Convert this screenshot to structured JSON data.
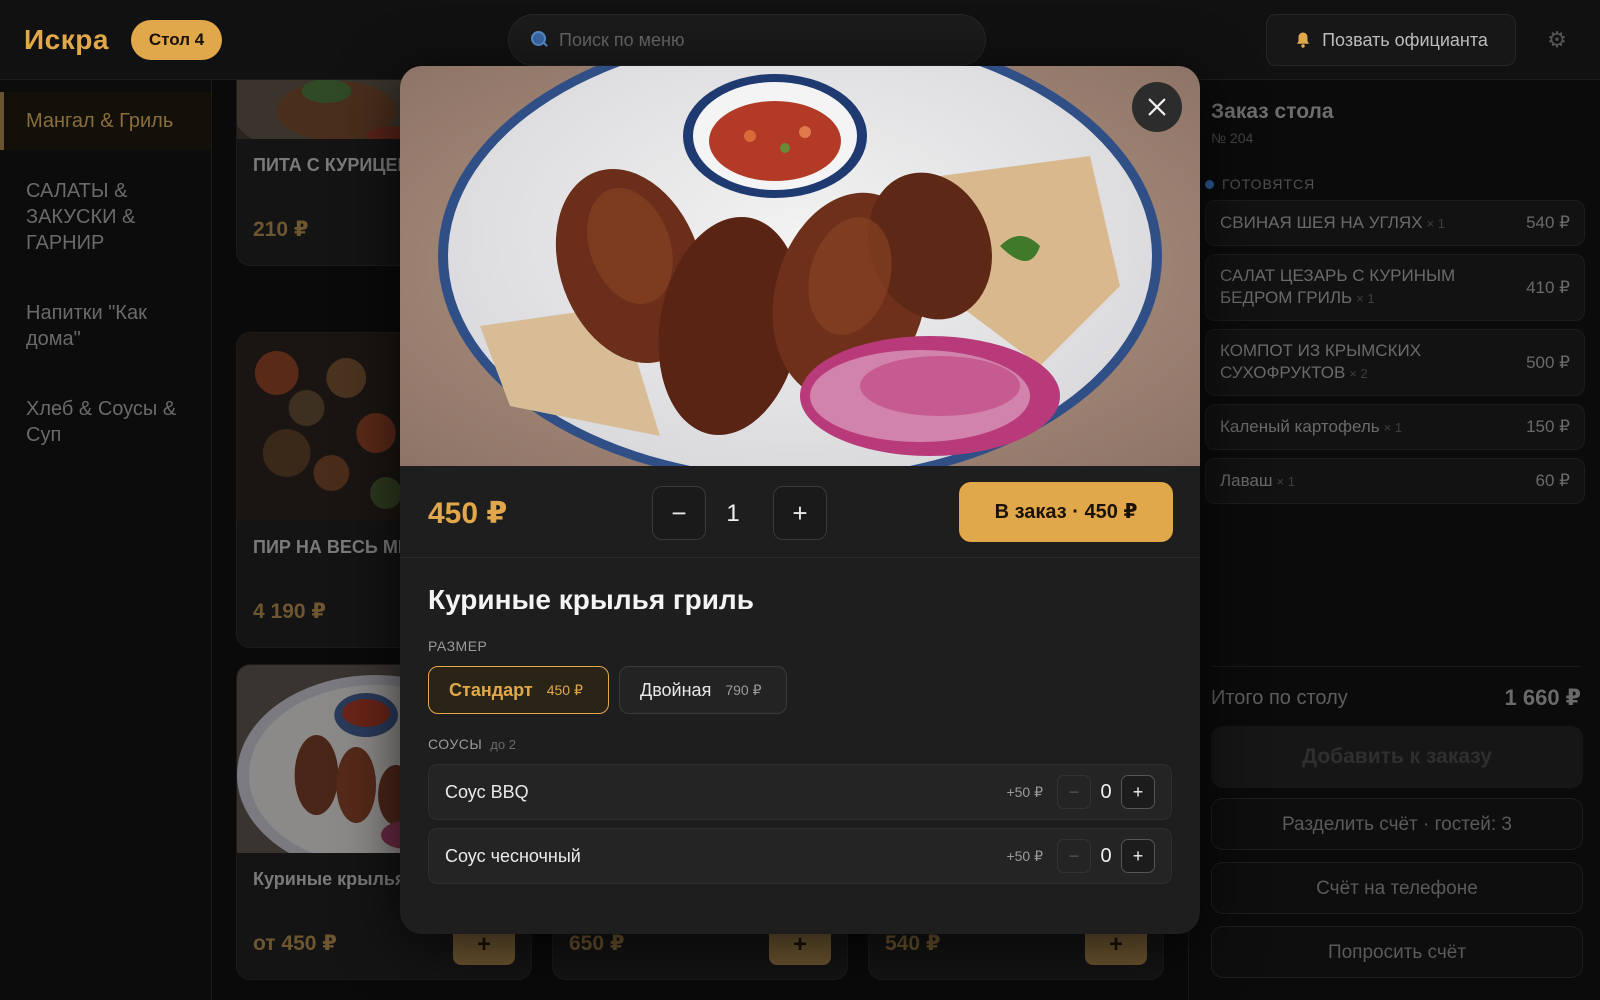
{
  "header": {
    "brand": "Искра",
    "table_badge": "Стол 4",
    "search_placeholder": "Поиск по меню",
    "call_waiter": "Позвать официанта"
  },
  "sidebar": {
    "items": [
      {
        "label": "Мангал & Гриль",
        "active": true
      },
      {
        "label": "САЛАТЫ & ЗАКУСКИ & ГАРНИР",
        "active": false
      },
      {
        "label": "Напитки \"Как дома\"",
        "active": false
      },
      {
        "label": "Хлеб & Соусы & Суп",
        "active": false
      }
    ]
  },
  "menu": {
    "cards": [
      {
        "title": "ПИТА С КУРИЦЕЙ",
        "price": "210 ₽"
      },
      {
        "title": "ПИР НА ВЕСЬ МИР",
        "price": "4 190 ₽"
      },
      {
        "title": "Куриные крылья",
        "price": "от 450 ₽"
      },
      {
        "title": "",
        "price": "650 ₽"
      },
      {
        "title": "",
        "price": "540 ₽"
      }
    ],
    "add_glyph": "+"
  },
  "order": {
    "title": "Заказ стола",
    "number": "№ 204",
    "status": "ГОТОВЯТСЯ",
    "items": [
      {
        "name": "СВИНАЯ ШЕЯ НА УГЛЯХ",
        "qty": "× 1",
        "price": "540 ₽"
      },
      {
        "name": "САЛАТ ЦЕЗАРЬ С КУРИНЫМ БЕДРОМ ГРИЛЬ",
        "qty": "× 1",
        "price": "410 ₽"
      },
      {
        "name": "КОМПОТ ИЗ КРЫМСКИХ СУХОФРУКТОВ",
        "qty": "× 2",
        "price": "500 ₽"
      },
      {
        "name": "Каленый картофель",
        "qty": "× 1",
        "price": "150 ₽"
      },
      {
        "name": "Лаваш",
        "qty": "× 1",
        "price": "60 ₽"
      }
    ],
    "total_label": "Итого по столу",
    "total_value": "1 660 ₽",
    "add_to_order": "Добавить к заказу",
    "split_bill": "Разделить счёт · гостей: 3",
    "bill_phone": "Счёт на телефоне",
    "request_bill": "Попросить счёт"
  },
  "modal": {
    "price": "450 ₽",
    "quantity": "1",
    "minus": "−",
    "plus": "+",
    "add_button": "В заказ · 450 ₽",
    "title": "Куриные крылья гриль",
    "size_label": "РАЗМЕР",
    "sizes": [
      {
        "label": "Стандарт",
        "price": "450 ₽",
        "selected": true
      },
      {
        "label": "Двойная",
        "price": "790 ₽",
        "selected": false
      }
    ],
    "sauces_label": "СОУСЫ",
    "sauces_limit": "до 2",
    "sauces": [
      {
        "name": "Соус BBQ",
        "price": "+50 ₽",
        "qty": "0"
      },
      {
        "name": "Соус чесночный",
        "price": "+50 ₽",
        "qty": "0"
      }
    ]
  },
  "colors": {
    "accent": "#e0a84b",
    "background": "#0a0a0a",
    "modal_bg": "#1e1e1e",
    "status_dot": "#2e5d9a"
  },
  "icons": [
    "search-icon",
    "bell-icon",
    "gear-icon",
    "close-icon"
  ]
}
